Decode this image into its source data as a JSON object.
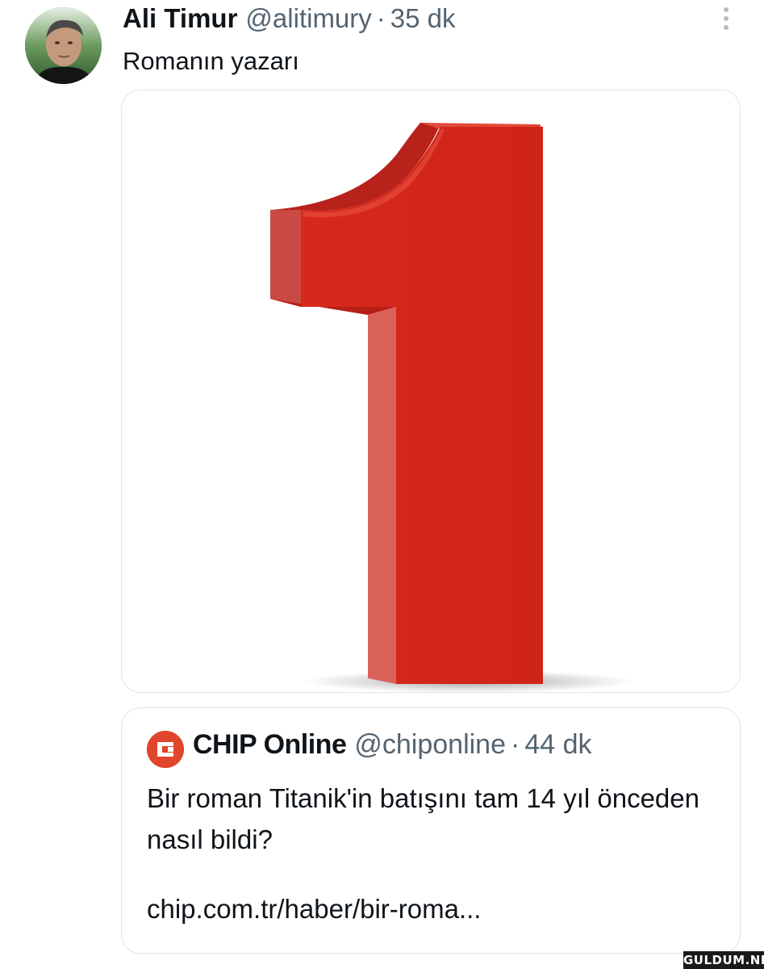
{
  "tweet": {
    "author_name": "Ali Timur",
    "handle": "@alitimury",
    "separator": "·",
    "time": "35 dk",
    "text": "Romanın yazarı",
    "media_icon": "number-one-3d-image"
  },
  "quote": {
    "author_name": "CHIP Online",
    "handle": "@chiponline",
    "separator": "·",
    "time": "44 dk",
    "text": "Bir roman Titanik'in batışını tam 14 yıl önceden nasıl bildi?",
    "link": "chip.com.tr/haber/bir-roma...",
    "avatar_color": "#e0452d"
  },
  "watermark": "GULDUM.NET",
  "colors": {
    "text_primary": "#0f1419",
    "text_secondary": "#536471",
    "number_red": "#d42a1e",
    "border": "#e1e6ea"
  }
}
